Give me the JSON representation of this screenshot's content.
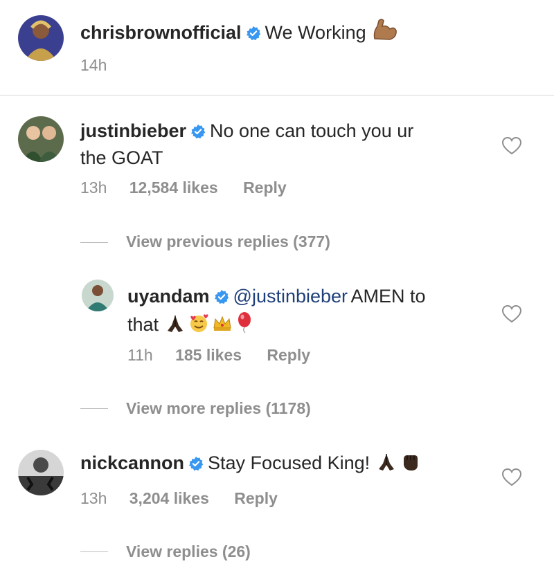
{
  "post": {
    "username": "chrisbrownofficial",
    "caption": "We Working",
    "caption_emoji": "flexed-biceps-icon",
    "time": "14h"
  },
  "comments": [
    {
      "username": "justinbieber",
      "text_line1": "No one can touch you ur",
      "text_line2": "the GOAT",
      "time": "13h",
      "likes": "12,584 likes",
      "reply": "Reply",
      "view_replies": "View previous replies (377)"
    },
    {
      "username": "uyandam",
      "mention": "@justinbieber",
      "text_line1": "AMEN to",
      "text_line2": "that",
      "emojis": [
        "folded-hands-icon",
        "smiling-face-with-hearts-icon",
        "crown-icon",
        "balloon-icon"
      ],
      "time": "11h",
      "likes": "185 likes",
      "reply": "Reply",
      "view_replies": "View more replies (1178)"
    },
    {
      "username": "nickcannon",
      "text_line1": "Stay Focused King!",
      "emojis": [
        "folded-hands-icon",
        "raised-fist-icon"
      ],
      "time": "13h",
      "likes": "3,204 likes",
      "reply": "Reply",
      "view_replies": "View replies (26)"
    }
  ],
  "colors": {
    "verified_badge": "#3897f0",
    "meta_gray": "#8e8e8e",
    "mention_blue": "#1e3f7a"
  }
}
